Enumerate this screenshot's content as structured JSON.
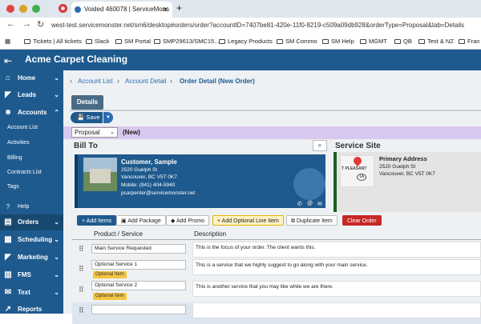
{
  "browser": {
    "tab_title": "Voided 460078 | ServiceMons",
    "new_tab": "+",
    "url": "west-test.servicemonster.net/sm6/desktop#orders/order?accountID=7407be81-420e-11f0-8219-c509a09db928&orderType=Proposal&tab=Details",
    "bookmarks": [
      "Tickets | All tickets",
      "Slack",
      "SM Portal",
      "SMP29613/SMC15...",
      "Legacy Products",
      "SM Commo",
      "SM Help",
      "MGMT",
      "QB",
      "Test & NZ",
      "Fran"
    ]
  },
  "app": {
    "title": "Acme Carpet Cleaning"
  },
  "sidebar": {
    "items": [
      {
        "label": "Home"
      },
      {
        "label": "Leads"
      },
      {
        "label": "Accounts"
      }
    ],
    "subitems": [
      "Account List",
      "Activities",
      "Billing",
      "Contracts List",
      "Tags"
    ],
    "bottom_items": [
      {
        "label": "Help"
      },
      {
        "label": "Orders"
      },
      {
        "label": "Scheduling"
      },
      {
        "label": "Marketing"
      },
      {
        "label": "FMS"
      },
      {
        "label": "Text"
      },
      {
        "label": "Reports"
      }
    ]
  },
  "breadcrumb": [
    "Account List",
    "Account Detail",
    "Order Detail (New Order)"
  ],
  "tabs": {
    "details": "Details"
  },
  "toolbar": {
    "save": "Save"
  },
  "order": {
    "type": "Proposal",
    "status": "(New)"
  },
  "bill_to": {
    "heading": "Bill To",
    "name": "Customer, Sample",
    "street": "2520 Guelph St",
    "city": "Vancouver, BC V5T 0K7",
    "mobile": "Mobile: (941) 404-5940",
    "email": "pcarpenter@servicemonster.net"
  },
  "service_site": {
    "heading": "Service Site",
    "label": "Primary Address",
    "street": "2520 Guelph St",
    "city": "Vancouver, BC V5T 0K7",
    "map_label": "T PLEASANT",
    "map_badge": "1A"
  },
  "actions": {
    "add_items": "+ Add Items",
    "add_package": "Add Package",
    "add_promo": "Add Promo",
    "add_optional": "+ Add Optional Line Item",
    "duplicate": "Duplicate Item",
    "clear": "Clear Order"
  },
  "table": {
    "headers": [
      "Product / Service",
      "Description"
    ],
    "rows": [
      {
        "product": "Main Service Requested",
        "optional": "",
        "description": "This is the focus of your order. The client wants this."
      },
      {
        "product": "Optional Service 1",
        "optional": "Optional Item",
        "description": "This is a service that we highly suggest to go along with your main service."
      },
      {
        "product": "Optional Service 2",
        "optional": "Optional Item",
        "description": "This is another service that you may like while we are there."
      }
    ]
  }
}
